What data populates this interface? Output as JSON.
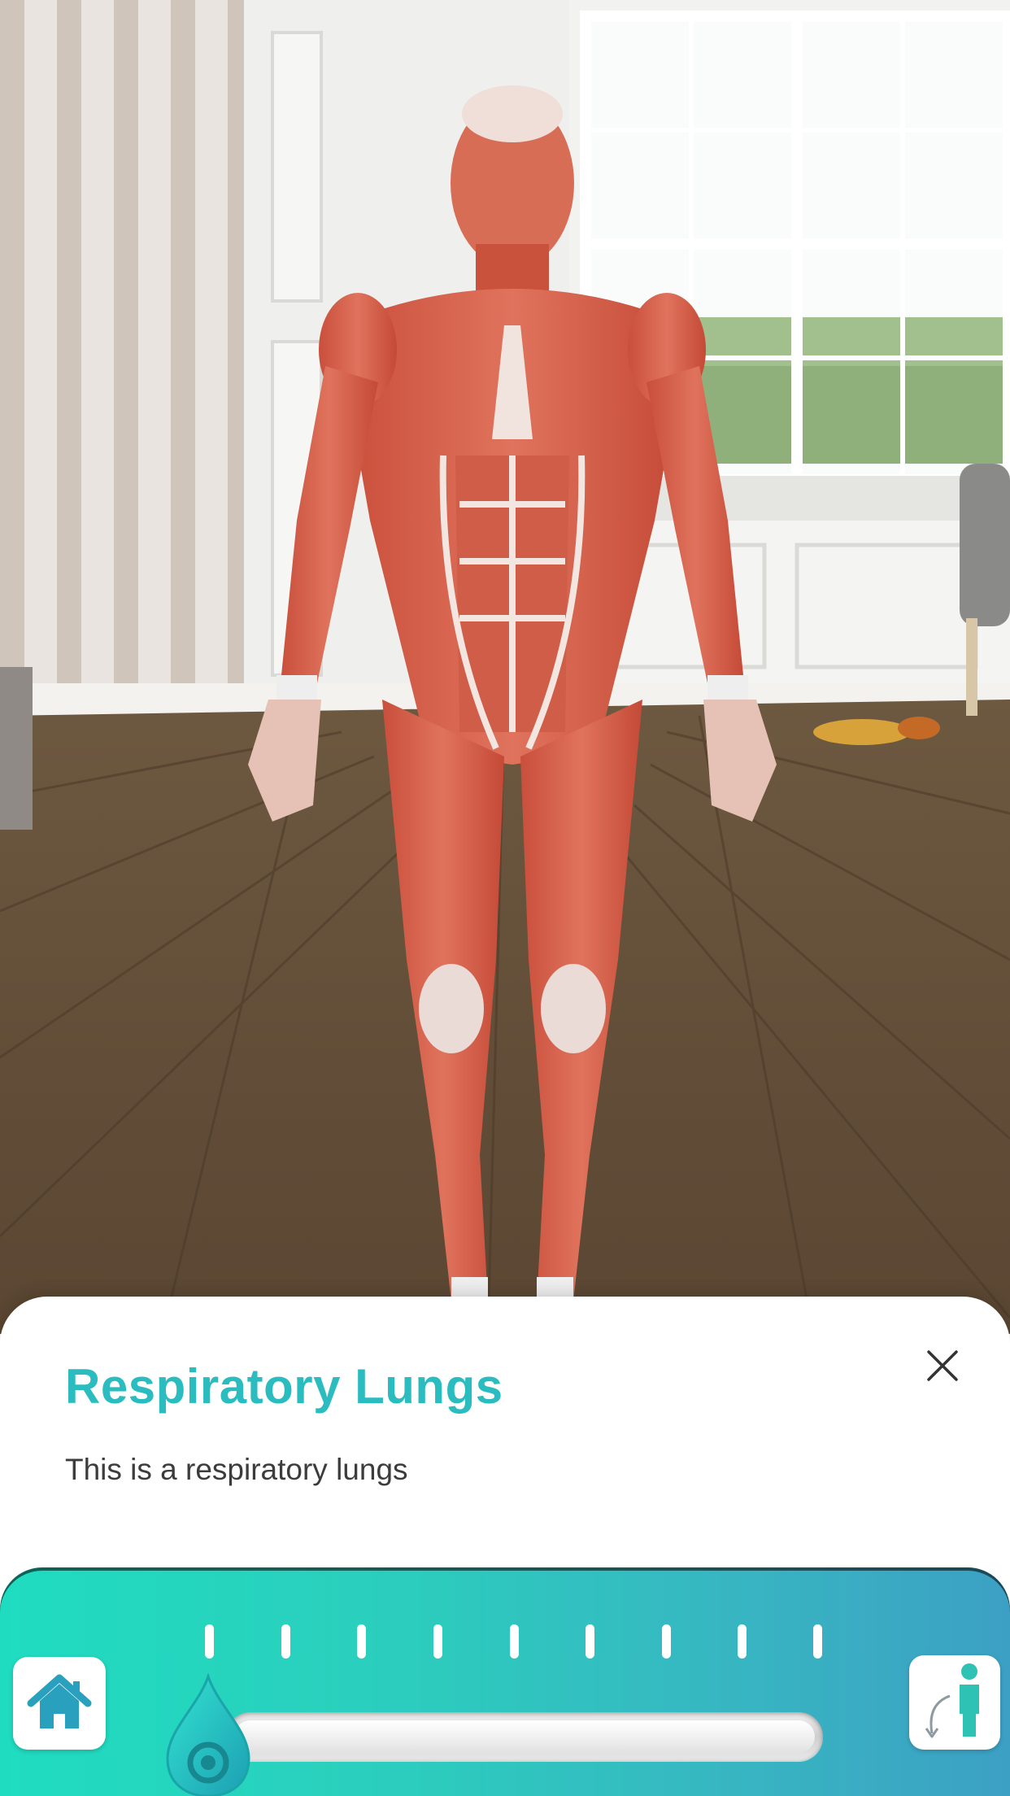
{
  "scene": {
    "background": "anatomy-model-in-living-room",
    "model_name": "muscular-anatomy-model"
  },
  "info_sheet": {
    "title": "Respiratory Lungs",
    "description": "This is a respiratory lungs",
    "close_icon": "close-icon",
    "title_color": "#2bbcc0"
  },
  "control_bar": {
    "gradient_start": "#1fdcc0",
    "gradient_end": "#3ca0c4",
    "tick_count": 9,
    "home_icon": "home-icon",
    "body_view_icon": "body-view-icon",
    "slider_value": 0.0
  }
}
